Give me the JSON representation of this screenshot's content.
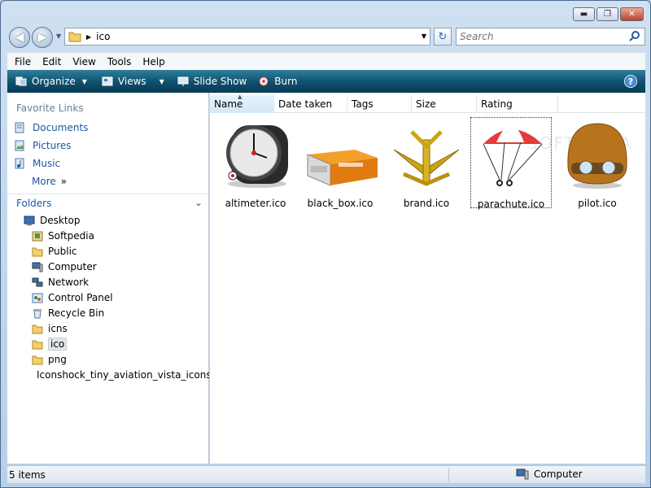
{
  "window": {
    "min": "▬",
    "max": "❐",
    "close": "✕"
  },
  "nav": {
    "back": "◀",
    "forward": "▶"
  },
  "address": {
    "path": "ico",
    "separator": "▶",
    "dropdown": "▼",
    "refresh": "↻"
  },
  "search": {
    "placeholder": "Search",
    "icon": "search-icon"
  },
  "menu": {
    "items": [
      "File",
      "Edit",
      "View",
      "Tools",
      "Help"
    ]
  },
  "toolbar": {
    "organize": "Organize",
    "views": "Views",
    "slideshow": "Slide Show",
    "burn": "Burn",
    "help": "?"
  },
  "sidebar": {
    "favorites_title": "Favorite Links",
    "favorites": [
      {
        "label": "Documents",
        "icon": "documents-icon"
      },
      {
        "label": "Pictures",
        "icon": "pictures-icon"
      },
      {
        "label": "Music",
        "icon": "music-icon"
      }
    ],
    "more": "More",
    "more_arrow": "»",
    "folders_title": "Folders",
    "tree": [
      {
        "label": "Desktop"
      },
      {
        "label": "Softpedia"
      },
      {
        "label": "Public"
      },
      {
        "label": "Computer"
      },
      {
        "label": "Network"
      },
      {
        "label": "Control Panel"
      },
      {
        "label": "Recycle Bin"
      },
      {
        "label": "icns"
      },
      {
        "label": "ico"
      },
      {
        "label": "png"
      },
      {
        "label": "Iconshock_tiny_aviation_vista_icons.z"
      }
    ]
  },
  "columns": [
    "Name",
    "Date taken",
    "Tags",
    "Size",
    "Rating"
  ],
  "files": [
    {
      "name": "altimeter.ico"
    },
    {
      "name": "black_box.ico"
    },
    {
      "name": "brand.ico"
    },
    {
      "name": "parachute.ico"
    },
    {
      "name": "pilot.ico"
    }
  ],
  "watermark": "SOFTPEDIA",
  "status": {
    "count": "5 items",
    "location": "Computer"
  }
}
